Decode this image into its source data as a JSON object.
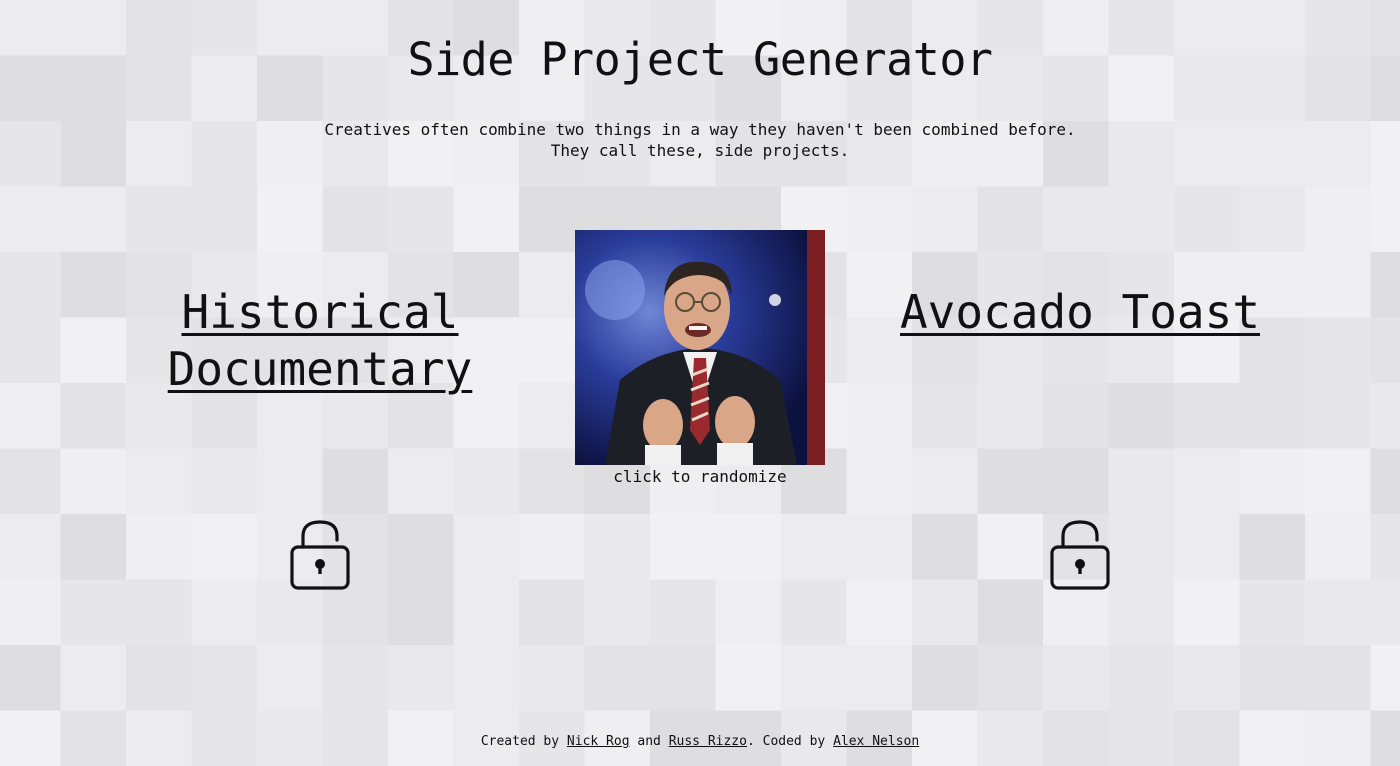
{
  "header": {
    "title": "Side Project Generator",
    "subtitle_line1": "Creatives often combine two things in a way they haven't been combined before.",
    "subtitle_line2": "They call these, side projects."
  },
  "generator": {
    "left_word": "Historical Documentary",
    "right_word": "Avocado Toast",
    "randomize_caption": "click to randomize",
    "left_lock_state": "unlocked",
    "right_lock_state": "unlocked"
  },
  "footer": {
    "created_by_prefix": "Created by",
    "author1": "Nick Rog",
    "and_text": "and",
    "author2": "Russ Rizzo",
    "coded_by_prefix": ". Coded by",
    "coder": "Alex Nelson"
  },
  "colors": {
    "background": "#e9e9eb",
    "text": "#111111"
  },
  "icons": {
    "lock_left": "padlock-unlocked-icon",
    "lock_right": "padlock-unlocked-icon"
  }
}
